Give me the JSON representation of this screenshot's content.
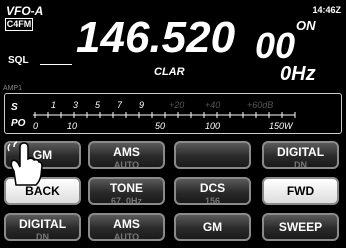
{
  "header": {
    "vfo": "VFO-A",
    "clock": "14:46Z",
    "memory": "C4FM",
    "frequency_main": "146.520",
    "frequency_sub": "00",
    "mode": "ON",
    "sql_label": "SQL"
  },
  "clar": {
    "label": "CLAR",
    "value": "0Hz"
  },
  "meter": {
    "amp_label": "AMP1",
    "s_label": "S",
    "po_label": "PO",
    "s_ticks": [
      "1",
      "3",
      "5",
      "7",
      "9",
      "+20",
      "+40",
      "+60dB"
    ],
    "po_ticks": [
      "0",
      "10",
      "50",
      "100",
      "150W"
    ],
    "s_level": 0
  },
  "buttons": {
    "gm_1": "GM",
    "ams_1": "AMS",
    "ams_1_sub": "AUTO",
    "blank": "",
    "digital_1": "DIGITAL",
    "digital_1_sub": "DN",
    "back": "BACK",
    "tone": "TONE",
    "tone_sub": "67. 0Hz",
    "dcs": "DCS",
    "dcs_sub": "156",
    "fwd": "FWD",
    "digital_2": "DIGITAL",
    "digital_2_sub": "DN",
    "ams_2": "AMS",
    "ams_2_sub": "AUTO",
    "gm_2": "GM",
    "sweep": "SWEEP"
  },
  "colors": {
    "background": "#000000",
    "text": "#ffffff",
    "sub_text": "#777777",
    "dim_scale": "#555555"
  }
}
